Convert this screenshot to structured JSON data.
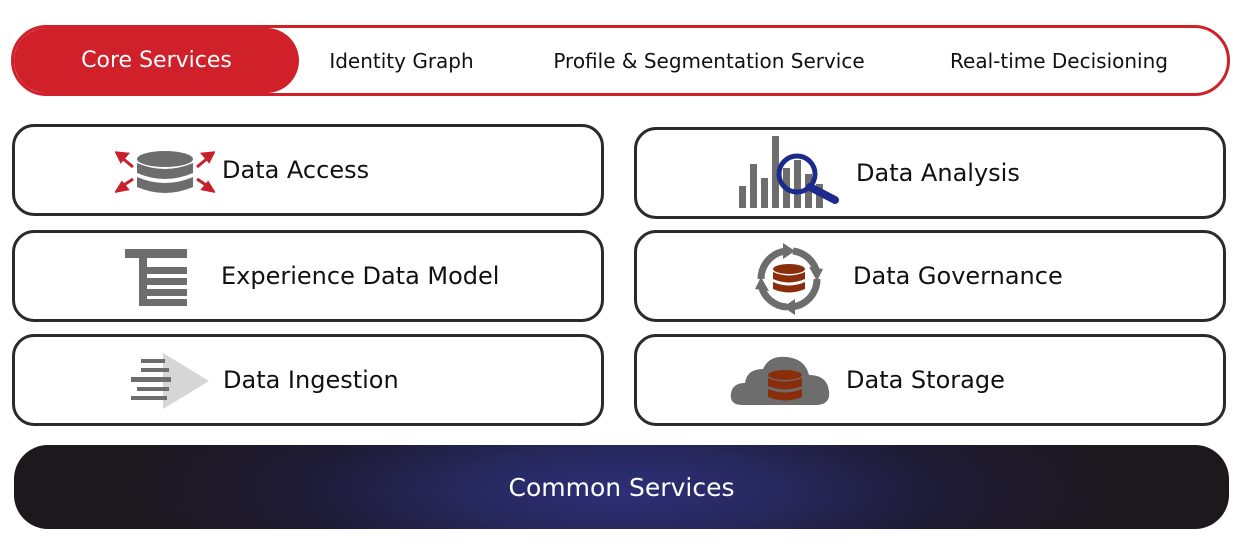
{
  "tabs": [
    {
      "label": "Core Services",
      "active": true
    },
    {
      "label": "Identity Graph",
      "active": false
    },
    {
      "label": "Profile & Segmentation Service",
      "active": false
    },
    {
      "label": "Real-time Decisioning",
      "active": false
    }
  ],
  "services": {
    "data_access": "Data Access",
    "data_analysis": "Data Analysis",
    "experience_data_model": "Experience Data Model",
    "data_governance": "Data Governance",
    "data_ingestion": "Data Ingestion",
    "data_storage": "Data Storage"
  },
  "footer": {
    "label": "Common Services"
  },
  "colors": {
    "accent": "#d0202a",
    "icon_gray": "#6d6d6d",
    "database_brown": "#8a2d0a",
    "magnifier_blue": "#1c2a8c",
    "footer_dark": "#1c181c",
    "footer_glow": "#2d2f78"
  },
  "icons": [
    "database-arrows-icon",
    "bar-chart-magnifier-icon",
    "schema-model-icon",
    "database-cycle-icon",
    "ingestion-arrow-icon",
    "cloud-database-icon"
  ]
}
